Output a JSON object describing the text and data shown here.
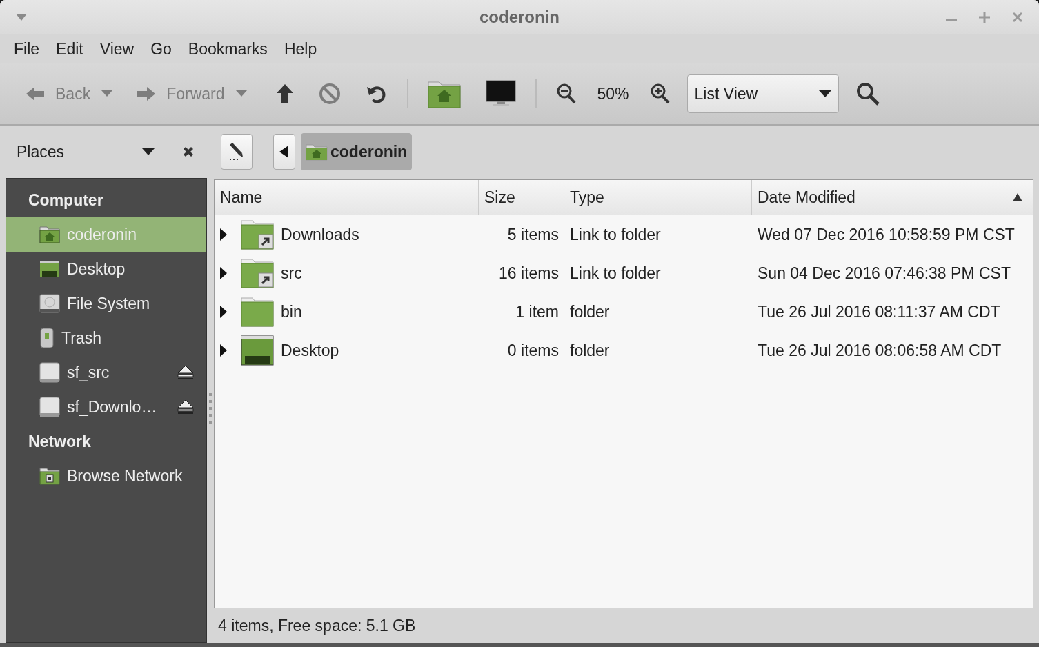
{
  "window": {
    "title": "coderonin"
  },
  "menu": [
    "File",
    "Edit",
    "View",
    "Go",
    "Bookmarks",
    "Help"
  ],
  "toolbar": {
    "back": {
      "label": "Back",
      "disabled": true
    },
    "forward": {
      "label": "Forward",
      "disabled": true
    },
    "stop_disabled": true,
    "zoom": "50%",
    "view": "List View"
  },
  "location": {
    "path": [
      {
        "label": "coderonin",
        "selected": true
      }
    ]
  },
  "sidebar": {
    "title": "Places",
    "sections": [
      {
        "heading": "Computer",
        "items": [
          {
            "label": "coderonin",
            "kind": "home",
            "selected": true,
            "ejectable": false
          },
          {
            "label": "Desktop",
            "kind": "desktop",
            "selected": false,
            "ejectable": false
          },
          {
            "label": "File System",
            "kind": "drive",
            "selected": false,
            "ejectable": false
          },
          {
            "label": "Trash",
            "kind": "trash",
            "selected": false,
            "ejectable": false
          },
          {
            "label": "sf_src",
            "kind": "volume",
            "selected": false,
            "ejectable": true
          },
          {
            "label": "sf_Downlo…",
            "kind": "volume",
            "selected": false,
            "ejectable": true
          }
        ]
      },
      {
        "heading": "Network",
        "items": [
          {
            "label": "Browse Network",
            "kind": "network",
            "selected": false,
            "ejectable": false
          }
        ]
      }
    ]
  },
  "table": {
    "columns": [
      {
        "label": "Name",
        "sorted": false
      },
      {
        "label": "Size",
        "sorted": false
      },
      {
        "label": "Type",
        "sorted": false
      },
      {
        "label": "Date Modified",
        "sorted": true
      }
    ],
    "rows": [
      {
        "name": "Downloads",
        "kind": "link",
        "size": "5 items",
        "type": "Link to folder",
        "modified": "Wed 07 Dec 2016 10:58:59 PM CST"
      },
      {
        "name": "src",
        "kind": "link",
        "size": "16 items",
        "type": "Link to folder",
        "modified": "Sun 04 Dec 2016 07:46:38 PM CST"
      },
      {
        "name": "bin",
        "kind": "folder",
        "size": "1 item",
        "type": "folder",
        "modified": "Tue 26 Jul 2016 08:11:37 AM CDT"
      },
      {
        "name": "Desktop",
        "kind": "desktop",
        "size": "0 items",
        "type": "folder",
        "modified": "Tue 26 Jul 2016 08:06:58 AM CDT"
      }
    ]
  },
  "status_bar": "4 items, Free space: 5.1 GB"
}
